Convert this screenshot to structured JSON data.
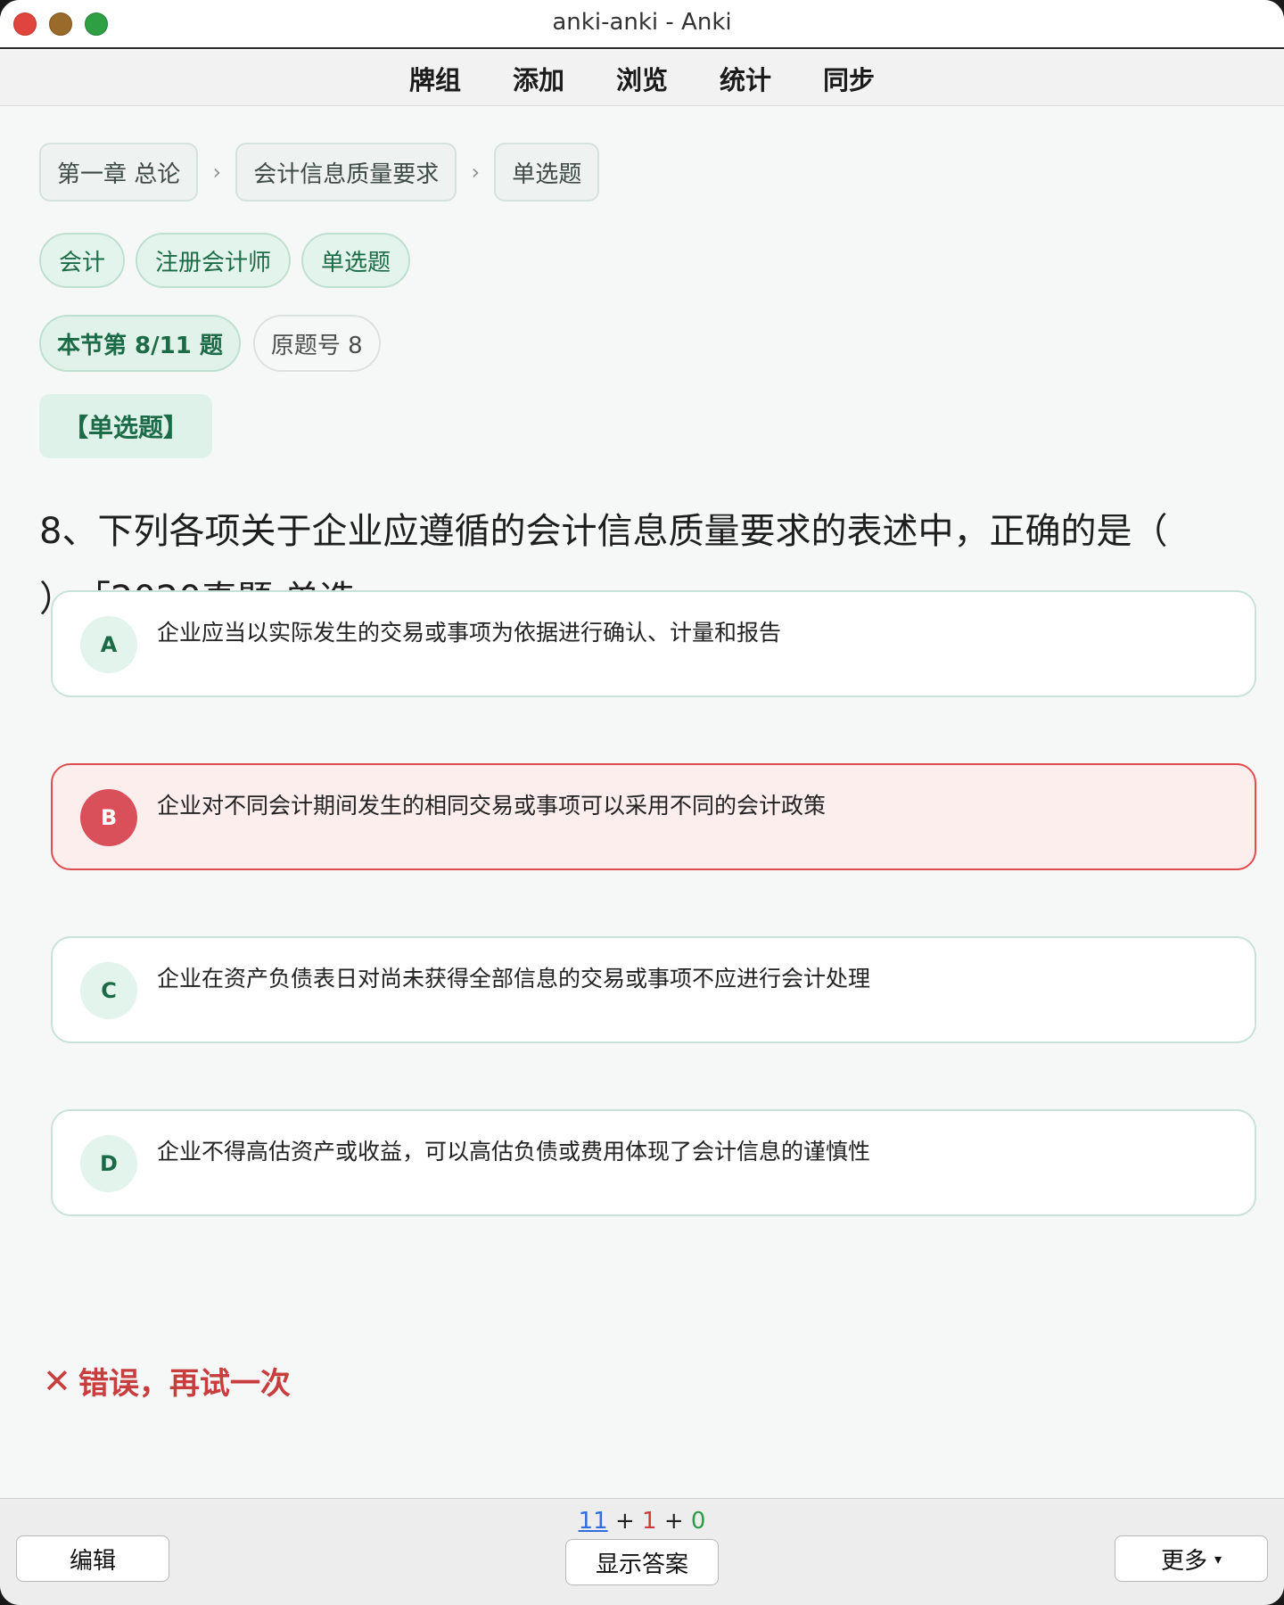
{
  "window": {
    "title": "anki-anki - Anki",
    "colors": {
      "close": "#e0443e",
      "minimize": "#9a6a2a",
      "zoom": "#2ea043"
    }
  },
  "toolbar": {
    "items": [
      "牌组",
      "添加",
      "浏览",
      "统计",
      "同步"
    ]
  },
  "breadcrumb": {
    "items": [
      "第一章 总论",
      "会计信息质量要求",
      "单选题"
    ],
    "separator": "›"
  },
  "tags": [
    "会计",
    "注册会计师",
    "单选题"
  ],
  "progress": {
    "section_label": "本节第 8/11 题",
    "original_label": "原题号 8"
  },
  "question_type": "【单选题】",
  "question": {
    "line1": "8、下列各项关于企业应遵循的会计信息质量要求的表述中，正确的是（",
    "line2": "）。「2020真题·单选」"
  },
  "options": [
    {
      "letter": "A",
      "text": "企业应当以实际发生的交易或事项为依据进行确认、计量和报告",
      "state": "normal"
    },
    {
      "letter": "B",
      "text": "企业对不同会计期间发生的相同交易或事项可以采用不同的会计政策",
      "state": "wrong"
    },
    {
      "letter": "C",
      "text": "企业在资产负债表日对尚未获得全部信息的交易或事项不应进行会计处理",
      "state": "normal"
    },
    {
      "letter": "D",
      "text": "企业不得高估资产或收益，可以高估负债或费用体现了会计信息的谨慎性",
      "state": "normal"
    }
  ],
  "feedback": {
    "icon": "✕",
    "text": "错误，再试一次",
    "color": "#c83e3e"
  },
  "bottombar": {
    "counts": {
      "new": "11",
      "learn": "1",
      "review": "0",
      "plus": "+"
    },
    "edit_label": "编辑",
    "show_answer_label": "显示答案",
    "more_label": "更多",
    "more_caret": "▾"
  }
}
